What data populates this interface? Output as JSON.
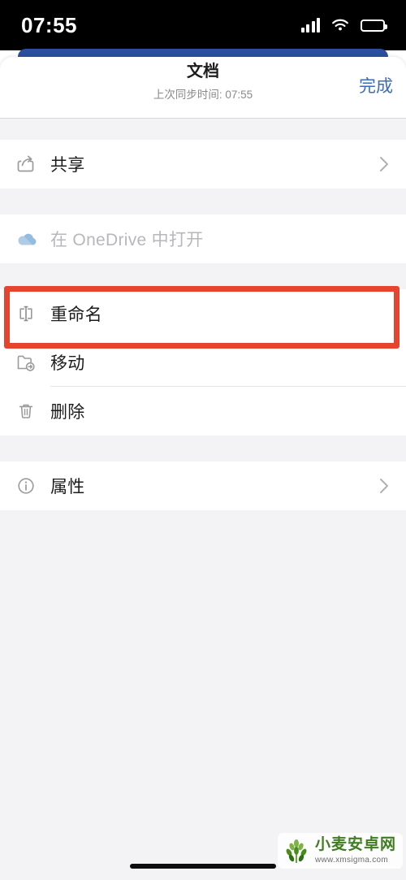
{
  "status_bar": {
    "time": "07:55",
    "signal_icon": "signal-bars-icon",
    "wifi_icon": "wifi-icon",
    "battery_icon": "battery-icon"
  },
  "sheet": {
    "title": "文档",
    "subtitle": "上次同步时间: 07:55",
    "done_label": "完成",
    "done_color": "#3a6bbf",
    "appbar_color": "#2B4F9E"
  },
  "groups": [
    {
      "rows": [
        {
          "id": "share",
          "label": "共享",
          "icon": "share-icon",
          "disabled": false,
          "chevron": true
        }
      ]
    },
    {
      "rows": [
        {
          "id": "open-in-onedrive",
          "label": "在 OneDrive 中打开",
          "icon": "cloud-icon",
          "disabled": true,
          "chevron": false
        }
      ]
    },
    {
      "rows": [
        {
          "id": "rename",
          "label": "重命名",
          "icon": "rename-icon",
          "disabled": false,
          "chevron": false,
          "highlighted": true
        },
        {
          "id": "move",
          "label": "移动",
          "icon": "move-folder-icon",
          "disabled": false,
          "chevron": false
        },
        {
          "id": "delete",
          "label": "删除",
          "icon": "trash-icon",
          "disabled": false,
          "chevron": false
        }
      ]
    },
    {
      "rows": [
        {
          "id": "properties",
          "label": "属性",
          "icon": "info-icon",
          "disabled": false,
          "chevron": true
        }
      ]
    }
  ],
  "annotation": {
    "target": "rename",
    "color": "#E5452F"
  },
  "watermark": {
    "name": "小麦安卓网",
    "url": "www.xmsigma.com",
    "logo_icon": "wheat-logo-icon",
    "color": "#3f7d20"
  },
  "home_indicator": "home-indicator"
}
